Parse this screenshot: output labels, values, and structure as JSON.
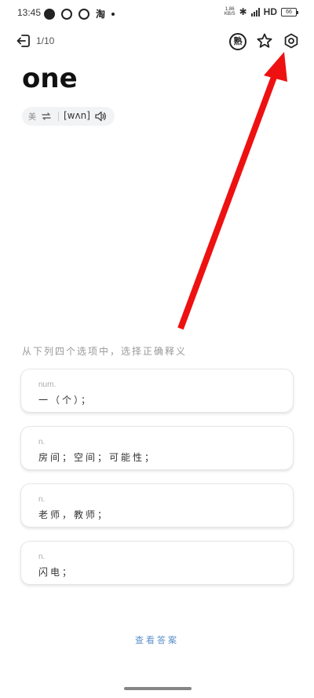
{
  "status_bar": {
    "time": "13:45",
    "taobao_glyph": "淘",
    "net_speed_value": "1.86",
    "net_speed_unit": "KB/S",
    "network_type": "HD",
    "battery": "66"
  },
  "header": {
    "progress": "1/10",
    "mastered_label": "熟"
  },
  "word": {
    "text": "one",
    "region": "美",
    "ipa": "[wʌn]"
  },
  "question": {
    "prompt": "从下列四个选项中，选择正确释义"
  },
  "options": [
    {
      "pos": "num.",
      "definition": "一（个）；"
    },
    {
      "pos": "n.",
      "definition": "房间；空间；可能性；"
    },
    {
      "pos": "n.",
      "definition": "老师，教师；"
    },
    {
      "pos": "n.",
      "definition": "闪电；"
    }
  ],
  "footer": {
    "reveal_answer": "查看答案"
  },
  "colors": {
    "arrow": "#ee1111",
    "link": "#5b8fc9"
  }
}
